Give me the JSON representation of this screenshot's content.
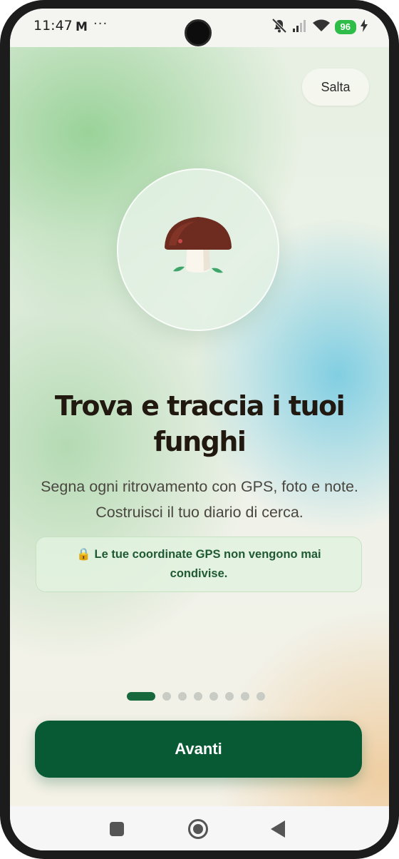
{
  "status_bar": {
    "time": "11:47",
    "mail_icon": "M",
    "more": "···",
    "battery": "96",
    "icons": [
      "mail-icon",
      "more-icon",
      "silent-icon",
      "signal-icon",
      "wifi-icon",
      "battery-icon",
      "charging-icon"
    ]
  },
  "onboarding": {
    "skip_label": "Salta",
    "hero_icon": "mushroom-icon",
    "title": "Trova e traccia i tuoi funghi",
    "subtitle": "Segna ogni ritrovamento con GPS, foto e note. Costruisci il tuo diario di cerca.",
    "privacy_note": "🔒 Le tue coordinate GPS non vengono mai condivise.",
    "page_dots": 8,
    "current_page": 1,
    "next_label": "Avanti"
  },
  "nav_bar": {
    "icons": [
      "recents-icon",
      "home-icon",
      "back-icon"
    ]
  },
  "colors": {
    "primary": "#075a34",
    "active_dot": "#18683e",
    "inactive_dot": "#c9cbc5",
    "title": "#21180f",
    "privacy_text": "#1f5a33",
    "battery": "#2fbd4a"
  }
}
